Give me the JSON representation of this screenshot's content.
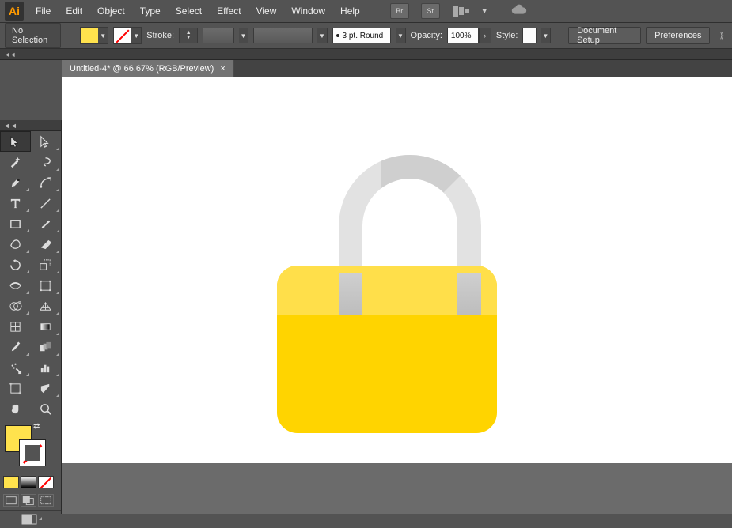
{
  "app": {
    "logo_text": "Ai"
  },
  "menu": {
    "items": [
      "File",
      "Edit",
      "Object",
      "Type",
      "Select",
      "Effect",
      "View",
      "Window",
      "Help"
    ],
    "br_label": "Br",
    "st_label": "St"
  },
  "control": {
    "selection_status": "No Selection",
    "fill_color": "#ffe24d",
    "stroke_label": "Stroke:",
    "brush_round": "3 pt. Round",
    "opacity_label": "Opacity:",
    "opacity_value": "100%",
    "style_label": "Style:",
    "doc_setup_btn": "Document Setup",
    "prefs_btn": "Preferences"
  },
  "document": {
    "tab_title": "Untitled-4* @ 66.67% (RGB/Preview)"
  },
  "tools": {
    "names": [
      "selection-tool",
      "direct-selection-tool",
      "magic-wand-tool",
      "lasso-tool",
      "pen-tool",
      "curvature-tool",
      "type-tool",
      "line-tool",
      "rectangle-tool",
      "paintbrush-tool",
      "shaper-tool",
      "eraser-tool",
      "rotate-tool",
      "scale-tool",
      "width-tool",
      "free-transform-tool",
      "shape-builder-tool",
      "perspective-grid-tool",
      "mesh-tool",
      "gradient-tool",
      "eyedropper-tool",
      "blend-tool",
      "symbol-sprayer-tool",
      "column-graph-tool",
      "artboard-tool",
      "slice-tool",
      "hand-tool",
      "zoom-tool"
    ]
  },
  "artwork": {
    "lock_body_color": "#ffd400",
    "lock_highlight_color": "#ffdf4a",
    "shackle_color": "#e2e2e2"
  }
}
